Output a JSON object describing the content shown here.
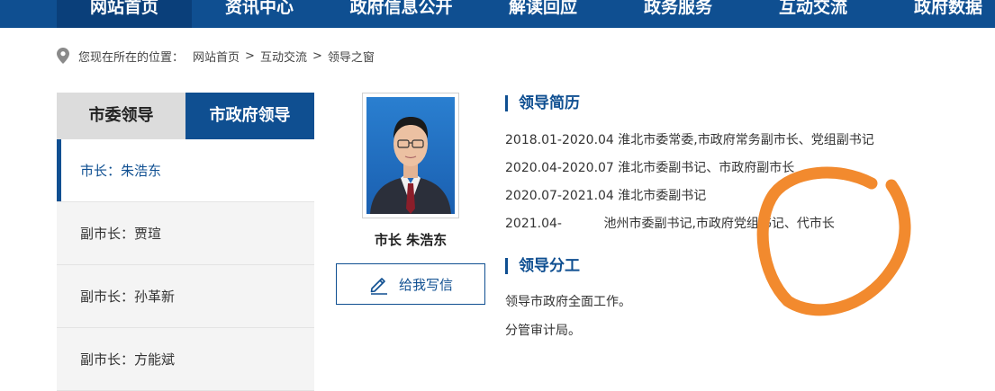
{
  "nav": {
    "items": [
      "网站首页",
      "资讯中心",
      "政府信息公开",
      "解读回应",
      "政务服务",
      "互动交流",
      "政府数据"
    ]
  },
  "breadcrumb": {
    "prefix": "您现在所在的位置：",
    "crumbs": [
      "网站首页",
      "互动交流",
      "领导之窗"
    ],
    "separator": ">"
  },
  "sidebar": {
    "tabs": [
      "市委领导",
      "市政府领导"
    ],
    "active_tab": "市政府领导",
    "leaders": [
      "市长：朱浩东",
      "副市长：贾瑄",
      "副市长：孙革新",
      "副市长：方能斌"
    ]
  },
  "profile": {
    "caption": "市长 朱浩东",
    "write_button": "给我写信"
  },
  "resume": {
    "title": "领导简历",
    "rows": [
      {
        "period": "2018.01-2020.04",
        "text": "淮北市委常委,市政府常务副市长、党组副书记"
      },
      {
        "period": "2020.04-2020.07",
        "text": "淮北市委副书记、市政府副市长"
      },
      {
        "period": "2020.07-2021.04",
        "text": "淮北市委副书记"
      },
      {
        "period": "2021.04-",
        "text": "池州市委副书记,市政府党组书记、代市长"
      }
    ]
  },
  "duties": {
    "title": "领导分工",
    "rows": [
      "领导市政府全面工作。",
      "分管审计局。"
    ]
  },
  "colors": {
    "brand": "#0f4f91",
    "annotation": "#f28a2e"
  }
}
